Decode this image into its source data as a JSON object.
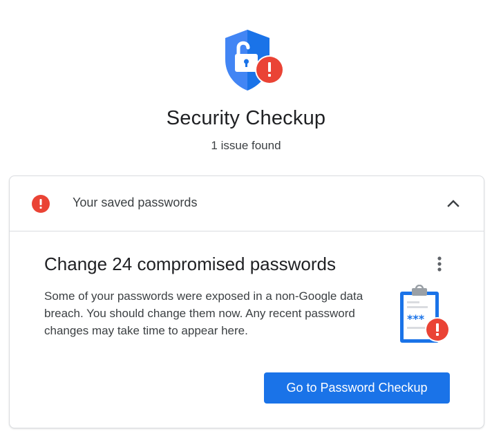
{
  "header": {
    "title": "Security Checkup",
    "subtitle": "1 issue found",
    "hero_icon": "shield-unlocked-alert-icon"
  },
  "card": {
    "section_label": "Your saved passwords",
    "section_icon": "alert-icon",
    "collapse_icon": "chevron-up-icon",
    "expanded": true,
    "item": {
      "title": "Change 24 compromised passwords",
      "description": "Some of your passwords were exposed in a non-Google data breach. You should change them now. Any recent password changes may take time to appear here.",
      "illustration": "clipboard-password-alert-icon",
      "illustration_text": "***",
      "menu_icon": "more-vert-icon",
      "action_label": "Go to Password Checkup"
    }
  },
  "colors": {
    "accent": "#1a73e8",
    "alert": "#ea4335",
    "text_primary": "#202124",
    "text_secondary": "#3c4043",
    "divider": "#dadce0"
  }
}
